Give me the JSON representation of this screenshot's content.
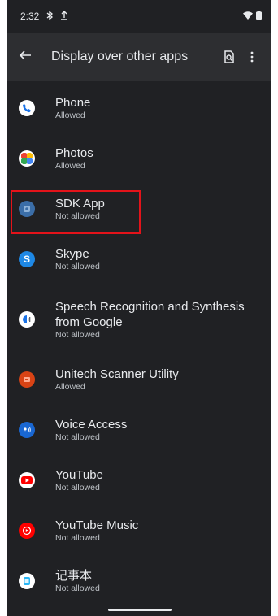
{
  "status_bar": {
    "time": "2:32"
  },
  "app_bar": {
    "title": "Display over other apps"
  },
  "apps": [
    {
      "name": "Phone",
      "status": "Allowed"
    },
    {
      "name": "Photos",
      "status": "Allowed"
    },
    {
      "name": "SDK App",
      "status": "Not allowed"
    },
    {
      "name": "Skype",
      "status": "Not allowed"
    },
    {
      "name": "Speech Recognition and Synthesis from Google",
      "status": "Not allowed"
    },
    {
      "name": "Unitech Scanner Utility",
      "status": "Allowed"
    },
    {
      "name": "Voice Access",
      "status": "Not allowed"
    },
    {
      "name": "YouTube",
      "status": "Not allowed"
    },
    {
      "name": "YouTube Music",
      "status": "Not allowed"
    },
    {
      "name": "记事本",
      "status": "Not allowed"
    }
  ],
  "colors": {
    "background": "#202124",
    "highlight": "#e3131a"
  }
}
